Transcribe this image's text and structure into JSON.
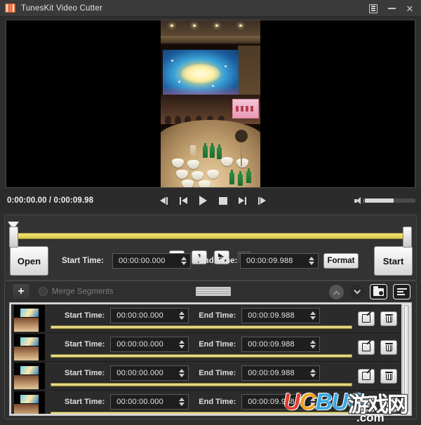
{
  "window": {
    "title": "TunesKit Video Cutter",
    "icon": "film-strip-icon",
    "controls": {
      "menu": "menu-icon",
      "minimize": "minimize-icon",
      "close": "close-icon"
    }
  },
  "player": {
    "current_time": "0:00:00.00",
    "separator": "/",
    "total_time": "0:00:09.98",
    "time_display": "0:00:00.00 / 0:00:09.98",
    "transport": [
      {
        "name": "jump-back-button",
        "icon": "skip-back-icon"
      },
      {
        "name": "step-back-button",
        "icon": "rewind-icon"
      },
      {
        "name": "play-button",
        "icon": "play-icon"
      },
      {
        "name": "stop-button",
        "icon": "stop-icon"
      },
      {
        "name": "step-forward-button",
        "icon": "forward-icon"
      },
      {
        "name": "jump-forward-button",
        "icon": "skip-forward-icon"
      }
    ],
    "volume": {
      "icon": "speaker-icon",
      "level_percent": 57
    }
  },
  "trim": {
    "buttons": [
      {
        "name": "set-start-marker-button",
        "label": "["
      },
      {
        "name": "set-end-marker-button",
        "label": "]"
      },
      {
        "name": "preview-selection-button",
        "icon": "play-cursor-icon"
      },
      {
        "name": "stop-preview-button",
        "icon": "stop-square-icon"
      }
    ]
  },
  "controls": {
    "open_label": "Open",
    "start_time_label": "Start Time:",
    "start_time_value": "00:00:00.000",
    "end_time_label": "End Time:",
    "end_time_value": "00:00:09.988",
    "format_label": "Format",
    "start_label": "Start"
  },
  "segments_panel": {
    "add_label": "+",
    "merge_label": "Merge Segments",
    "merge_checked": false,
    "tools": [
      {
        "name": "move-up-button",
        "icon": "chevron-up-icon",
        "enabled": false
      },
      {
        "name": "move-down-button",
        "icon": "chevron-down-icon",
        "enabled": true
      },
      {
        "name": "output-folder-button",
        "icon": "folder-image-icon"
      },
      {
        "name": "segment-list-button",
        "icon": "list-icon"
      }
    ],
    "rows": [
      {
        "start_label": "Start Time:",
        "start_value": "00:00:00.000",
        "end_label": "End Time:",
        "end_value": "00:00:09.988"
      },
      {
        "start_label": "Start Time:",
        "start_value": "00:00:00.000",
        "end_label": "End Time:",
        "end_value": "00:00:09.988"
      },
      {
        "start_label": "Start Time:",
        "start_value": "00:00:00.000",
        "end_label": "End Time:",
        "end_value": "00:00:09.988"
      },
      {
        "start_label": "Start Time:",
        "start_value": "00:00:00.000",
        "end_label": "End Time:",
        "end_value": "00:00:09.988"
      }
    ],
    "row_actions": {
      "edit": "edit-icon",
      "delete": "trash-icon"
    }
  },
  "watermark": {
    "u": "U",
    "c": "C",
    "bug": "BUG",
    "chinese": "游戏网",
    "com": ".com"
  },
  "colors": {
    "accent_yellow": "#e8da6a",
    "brand_orange": "#e8784a",
    "panel_bg": "#2f2f2f",
    "titlebar_bg": "#3a3a3a"
  }
}
